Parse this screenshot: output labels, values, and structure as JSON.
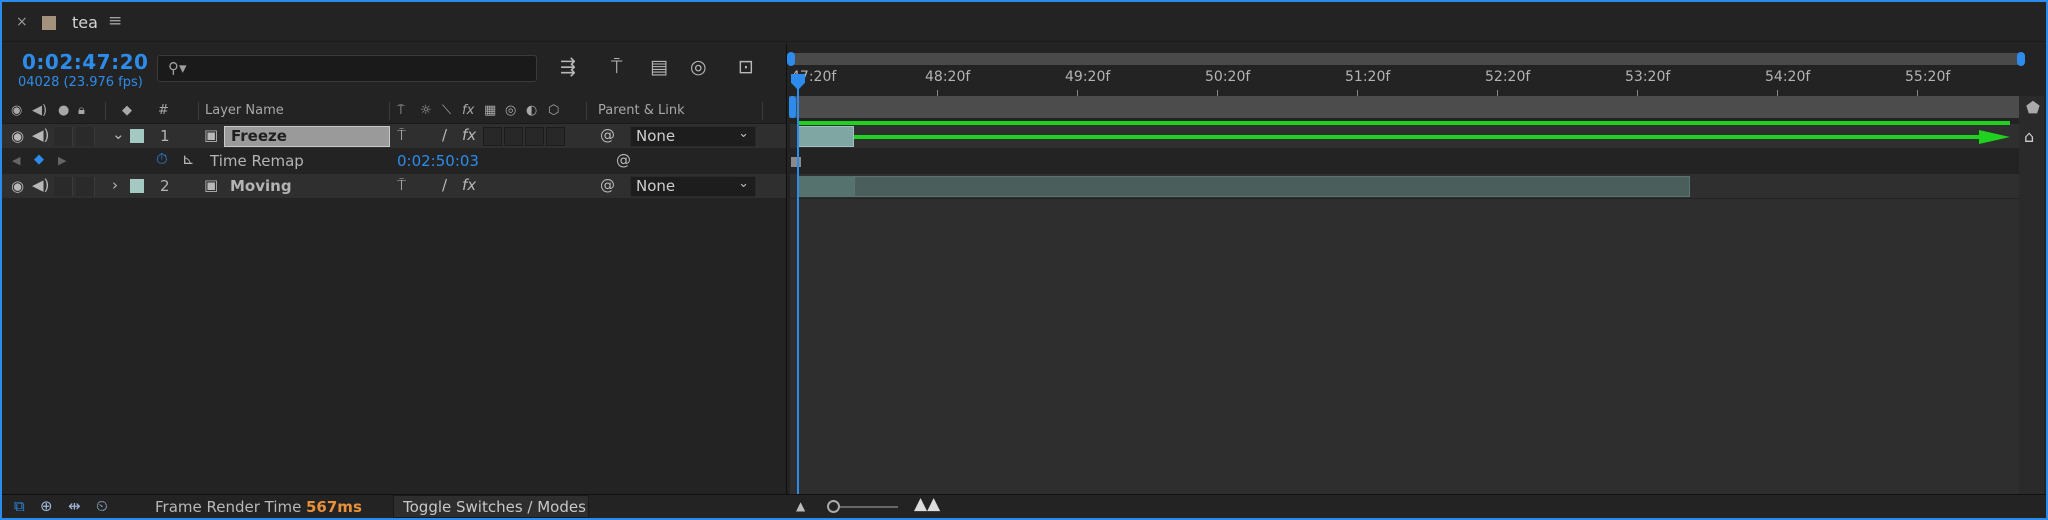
{
  "tab": {
    "close": "×",
    "title": "tea",
    "menu": "≡",
    "swatch_color": "#a3937c"
  },
  "timecode": {
    "current": "0:02:47:20",
    "frames_fps": "04028 (23.976 fps)"
  },
  "search": {
    "placeholder": ""
  },
  "columns": {
    "num": "#",
    "layer_name": "Layer Name",
    "parent_link": "Parent & Link",
    "fx": "fx"
  },
  "layers": [
    {
      "index": "1",
      "name": "Freeze",
      "expanded": true,
      "label_color": "#a3c9c2",
      "parent": "None",
      "fx": "fx"
    },
    {
      "index": "2",
      "name": "Moving",
      "expanded": false,
      "label_color": "#a3c9c2",
      "parent": "None",
      "fx": "fx"
    }
  ],
  "time_remap": {
    "label": "Time Remap",
    "value": "0:02:50:03"
  },
  "ruler": {
    "labels": [
      "47:20f",
      "48:20f",
      "49:20f",
      "50:20f",
      "51:20f",
      "52:20f",
      "53:20f",
      "54:20f",
      "55:20f"
    ]
  },
  "bottom": {
    "frame_render_label": "Frame Render Time",
    "frame_render_value": "567ms",
    "toggle_label": "Toggle Switches / Modes"
  },
  "colors": {
    "accent": "#2d8ceb",
    "keyframe_path": "#1fd21f",
    "render_time": "#e8913a"
  }
}
